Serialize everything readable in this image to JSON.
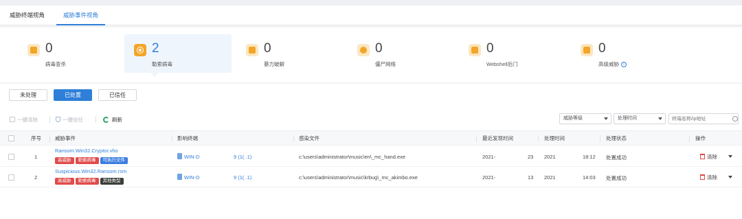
{
  "tabs": [
    {
      "label": "威胁终端视角"
    },
    {
      "label": "威胁事件视角"
    }
  ],
  "summary_cards": [
    {
      "icon": "virus-scan-icon",
      "count": "0",
      "label": "病毒查杀"
    },
    {
      "icon": "ransomware-icon",
      "count": "2",
      "label": "勒索病毒",
      "active": true
    },
    {
      "icon": "lock-icon",
      "count": "0",
      "label": "暴力破解"
    },
    {
      "icon": "botnet-icon",
      "count": "0",
      "label": "僵尸网络"
    },
    {
      "icon": "webshell-icon",
      "count": "0",
      "label": "Webshell后门"
    },
    {
      "icon": "advanced-threat-icon",
      "count": "0",
      "label": "高级威胁"
    }
  ],
  "status_filters": [
    "未处理",
    "已处置",
    "已信任"
  ],
  "toolbar": {
    "clear_label": "一键清除",
    "trust_label": "一键信任",
    "refresh_label": "刷新",
    "threat_level_select": "威胁等级",
    "handle_time_select": "处理时间",
    "search_placeholder": "终端名称/ip地址"
  },
  "table": {
    "headers": [
      "序号",
      "威胁事件",
      "影响终端",
      "感染文件",
      "最近发现时间",
      "处理时间",
      "处理状态",
      "操作"
    ],
    "rows": [
      {
        "index": "1",
        "event": "Ransom.Win32.Cryptor.vho",
        "tags": [
          {
            "text": "高威胁",
            "color": "#e04b4b"
          },
          {
            "text": "勒索病毒",
            "color": "#e04b4b"
          },
          {
            "text": "可执行文件",
            "color": "#3d7ee0"
          }
        ],
        "terminal": "WIN-D",
        "terminal_ip": "9 (1(          .1)",
        "file": "c:\\users\\administrator\\music\\en\\_mc_hand.exe",
        "found_date": "2021-",
        "found_time": "23",
        "handle_date": "2021",
        "handle_time": "18:12",
        "status": "处置成功",
        "action": "清除"
      },
      {
        "index": "2",
        "event": "Suspicious.Win32.Ransom.rsm",
        "tags": [
          {
            "text": "高威胁",
            "color": "#e04b4b"
          },
          {
            "text": "勒索病毒",
            "color": "#e04b4b"
          },
          {
            "text": "其他类型",
            "color": "#3a3f3a"
          }
        ],
        "terminal": "WIN-D",
        "terminal_ip": "9 (1(          .1)",
        "file": "c:\\users\\administrator\\music\\krbug\\_mc_akimbo.exe",
        "found_date": "2021-",
        "found_time": "13",
        "handle_date": "2021",
        "handle_time": "14:03",
        "status": "处置成功",
        "action": "清除"
      }
    ]
  }
}
